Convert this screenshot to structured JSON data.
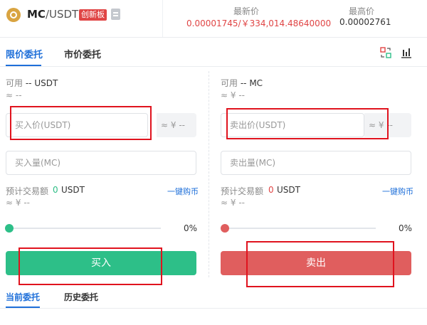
{
  "header": {
    "base": "MC",
    "quote": "/USDT",
    "badge": "创新板",
    "latest_label": "最新价",
    "latest_value": "0.00001745/￥334,014.48640000",
    "high_label": "最高价",
    "high_value": "0.00002761"
  },
  "tabs": {
    "limit": "限价委托",
    "market": "市价委托"
  },
  "buy": {
    "available": "可用",
    "available_value": "-- USDT",
    "approx": "≈ --",
    "price_placeholder": "买入价(USDT)",
    "price_suffix": "≈ ¥ --",
    "amount_placeholder": "买入量(MC)",
    "est_label": "预计交易额",
    "est_value": "0",
    "est_unit": "USDT",
    "est_approx": "≈ ¥ --",
    "quick_link": "一键购币",
    "percent": "0%",
    "button": "买入",
    "accent": "#2dbf88",
    "knob": "#2dbf88"
  },
  "sell": {
    "available": "可用",
    "available_value": "-- MC",
    "approx": "≈ ¥ --",
    "price_placeholder": "卖出价(USDT)",
    "price_suffix": "≈ ¥ --",
    "amount_placeholder": "卖出量(MC)",
    "est_label": "预计交易额",
    "est_value": "0",
    "est_unit": "USDT",
    "est_approx": "≈ ¥ --",
    "quick_link": "一键购币",
    "percent": "0%",
    "button": "卖出",
    "accent": "#e05e5e",
    "knob": "#e05e5e"
  },
  "bottom_tabs": {
    "current": "当前委托",
    "history": "历史委托"
  },
  "icons": [
    "coin-logo-icon",
    "document-icon",
    "swap-layout-icon",
    "chart-bars-icon"
  ]
}
